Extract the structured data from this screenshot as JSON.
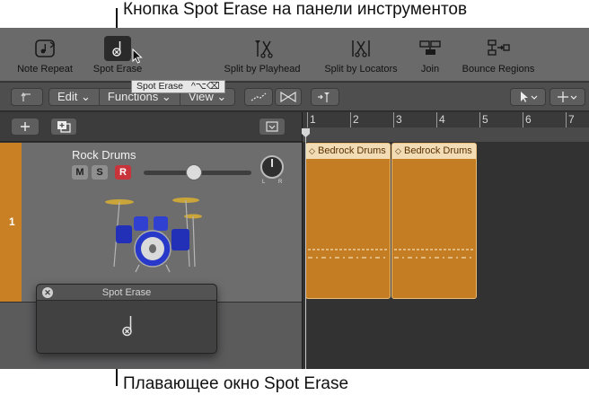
{
  "callouts": {
    "top": "Кнопка Spot Erase на панели инструментов",
    "bottom": "Плавающее окно Spot Erase"
  },
  "toolbar": {
    "tools": [
      {
        "id": "note-repeat",
        "label": "Note Repeat",
        "icon": "note-repeat-icon"
      },
      {
        "id": "spot-erase",
        "label": "Spot Erase",
        "icon": "spot-erase-icon",
        "active": true
      },
      {
        "id": "split-playhead",
        "label": "Split by Playhead",
        "icon": "split-playhead-icon"
      },
      {
        "id": "split-locators",
        "label": "Split by Locators",
        "icon": "split-locators-icon"
      },
      {
        "id": "join",
        "label": "Join",
        "icon": "join-icon"
      },
      {
        "id": "bounce-regions",
        "label": "Bounce Regions",
        "icon": "bounce-regions-icon"
      }
    ],
    "tooltip": "Spot Erase",
    "tooltip_shortcut": "^⌥⌫"
  },
  "control_bar": {
    "menus": [
      "Edit",
      "Functions",
      "View"
    ]
  },
  "ruler": {
    "bars": [
      "1",
      "2",
      "3",
      "4",
      "5",
      "6",
      "7"
    ]
  },
  "track": {
    "number": "1",
    "name": "Rock Drums",
    "mute": "M",
    "solo": "S",
    "record": "R",
    "pan_left": "L",
    "pan_right": "R",
    "volume_fraction": 0.47
  },
  "regions": [
    {
      "name": "Bedrock Drums"
    },
    {
      "name": "Bedrock Drums"
    }
  ],
  "floating_window": {
    "title": "Spot Erase"
  },
  "colors": {
    "region": "#c57d24",
    "region_header": "#f2dcb5",
    "track_color": "#c98024",
    "record": "#c8343a"
  }
}
